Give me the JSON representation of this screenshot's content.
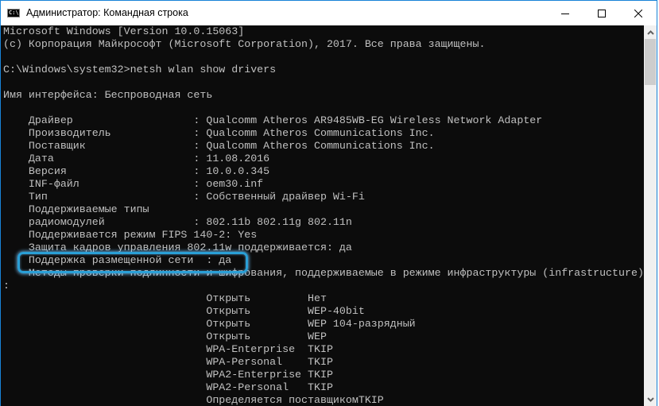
{
  "window": {
    "title": "Администратор: Командная строка",
    "icon_text": "C:\\",
    "accent": "#1883d7",
    "highlight_color": "#2a9fd6"
  },
  "console": {
    "lines": [
      "Microsoft Windows [Version 10.0.15063]",
      "(c) Корпорация Майкрософт (Microsoft Corporation), 2017. Все права защищены.",
      "",
      "C:\\Windows\\system32>netsh wlan show drivers",
      "",
      "Имя интерфейса: Беспроводная сеть",
      "",
      "    Драйвер                   : Qualcomm Atheros AR9485WB-EG Wireless Network Adapter",
      "    Производитель             : Qualcomm Atheros Communications Inc.",
      "    Поставщик                 : Qualcomm Atheros Communications Inc.",
      "    Дата                      : 11.08.2016",
      "    Версия                    : 10.0.0.345",
      "    INF-файл                  : oem30.inf",
      "    Тип                       : Собственный драйвер Wi-Fi",
      "    Поддерживаемые типы",
      "    радиомодулей              : 802.11b 802.11g 802.11n",
      "    Поддерживается режим FIPS 140-2: Yes",
      "    Защита кадров управления 802.11w поддерживается: да",
      "    Поддержка размещенной сети  : да",
      "    Методы проверки подлинности и шифрования, поддерживаемые в режиме инфраструктуры (infrastructure)",
      ":",
      "                                Открыть         Нет",
      "                                Открыть         WEP-40bit",
      "                                Открыть         WEP 104-разрядный",
      "                                Открыть         WEP",
      "                                WPA-Enterprise  TKIP",
      "                                WPA-Personal    TKIP",
      "                                WPA2-Enterprise TKIP",
      "                                WPA2-Personal   TKIP",
      "                                Определяется поставщикомTKIP"
    ]
  }
}
